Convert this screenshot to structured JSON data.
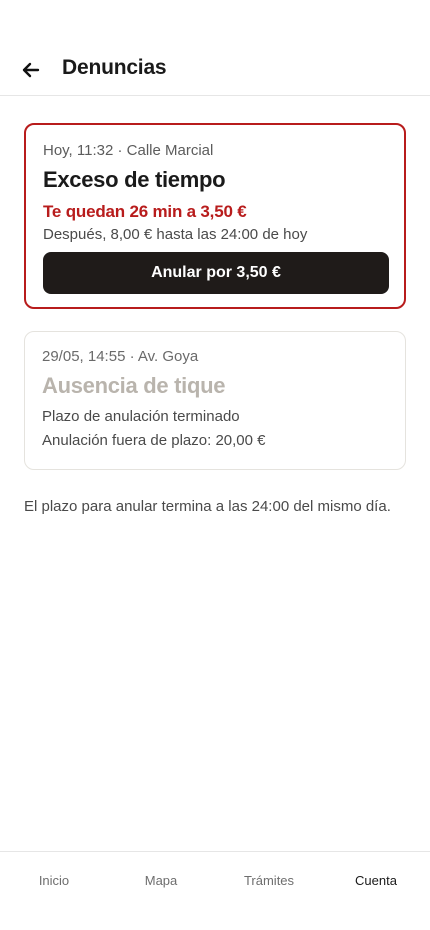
{
  "header": {
    "title": "Denuncias",
    "back_icon": "arrow-left-icon"
  },
  "fines": [
    {
      "meta": "Hoy, 11:32 · Calle Marcial",
      "title": "Exceso de tiempo",
      "countdown": "Te quedan 26 min a 3,50 €",
      "after": "Después, 8,00 € hasta las 24:00 de hoy",
      "button_label": "Anular por 3,50 €",
      "status": "active",
      "accent_color": "#b81c1c"
    },
    {
      "meta": "29/05, 14:55 · Av. Goya",
      "title": "Ausencia de tique",
      "line1": "Plazo de anulación terminado",
      "line2": "Anulación fuera de plazo: 20,00 €",
      "status": "expired"
    }
  ],
  "footnote": "El plazo para anular termina a las 24:00 del mismo día.",
  "nav": {
    "items": [
      {
        "label": "Inicio"
      },
      {
        "label": "Mapa"
      },
      {
        "label": "Trámites"
      },
      {
        "label": "Cuenta",
        "active": true
      }
    ]
  }
}
